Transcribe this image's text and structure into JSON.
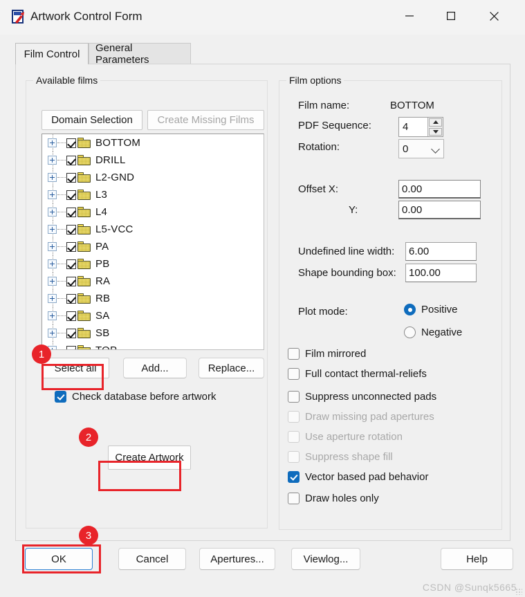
{
  "window": {
    "title": "Artwork Control Form",
    "icon": "artwork-app-icon",
    "minimize_label": "─",
    "maximize_label": "☐",
    "close_label": "✕"
  },
  "tabs": [
    {
      "label": "Film Control",
      "active": true
    },
    {
      "label": "General Parameters",
      "active": false
    }
  ],
  "available_films": {
    "group_label": "Available films",
    "buttons": {
      "domain_selection": "Domain Selection",
      "create_missing_films": "Create Missing Films",
      "select_all": "Select all",
      "add": "Add...",
      "replace": "Replace...",
      "create_artwork": "Create Artwork"
    },
    "tree_items": [
      {
        "label": "BOTTOM",
        "checked": true
      },
      {
        "label": "DRILL",
        "checked": true
      },
      {
        "label": "L2-GND",
        "checked": true
      },
      {
        "label": "L3",
        "checked": true
      },
      {
        "label": "L4",
        "checked": true
      },
      {
        "label": "L5-VCC",
        "checked": true
      },
      {
        "label": "PA",
        "checked": true
      },
      {
        "label": "PB",
        "checked": true
      },
      {
        "label": "RA",
        "checked": true
      },
      {
        "label": "RB",
        "checked": true
      },
      {
        "label": "SA",
        "checked": true
      },
      {
        "label": "SB",
        "checked": true
      },
      {
        "label": "TOP",
        "checked": true
      }
    ],
    "check_database": {
      "label": "Check database before artwork",
      "checked": true
    }
  },
  "film_options": {
    "group_label": "Film options",
    "film_name_label": "Film name:",
    "film_name_value": "BOTTOM",
    "pdf_sequence_label": "PDF Sequence:",
    "pdf_sequence_value": "4",
    "rotation_label": "Rotation:",
    "rotation_value": "0",
    "offset_x_label": "Offset  X:",
    "offset_x_value": "0.00",
    "offset_y_label": "Y:",
    "offset_y_value": "0.00",
    "undefined_line_width_label": "Undefined line width:",
    "undefined_line_width_value": "6.00",
    "shape_bounding_box_label": "Shape bounding box:",
    "shape_bounding_box_value": "100.00",
    "plot_mode_label": "Plot mode:",
    "plot_mode_options": [
      {
        "label": "Positive",
        "selected": true
      },
      {
        "label": "Negative",
        "selected": false
      }
    ],
    "checkboxes": [
      {
        "label": "Film mirrored",
        "checked": false,
        "disabled": false
      },
      {
        "label": "Full contact thermal-reliefs",
        "checked": false,
        "disabled": false
      },
      {
        "label": "Suppress unconnected pads",
        "checked": false,
        "disabled": false
      },
      {
        "label": "Draw missing pad apertures",
        "checked": false,
        "disabled": true
      },
      {
        "label": "Use aperture rotation",
        "checked": false,
        "disabled": true
      },
      {
        "label": "Suppress shape fill",
        "checked": false,
        "disabled": true
      },
      {
        "label": "Vector based pad behavior",
        "checked": true,
        "disabled": false
      },
      {
        "label": "Draw holes only",
        "checked": false,
        "disabled": false
      }
    ]
  },
  "bottom_buttons": [
    {
      "label": "OK",
      "focused": true
    },
    {
      "label": "Cancel",
      "focused": false
    },
    {
      "label": "Apertures...",
      "focused": false
    },
    {
      "label": "Viewlog...",
      "focused": false
    },
    {
      "label": "Help",
      "focused": false
    }
  ],
  "annotations": [
    {
      "number": "1",
      "target": "select-all-button"
    },
    {
      "number": "2",
      "target": "create-artwork-button"
    },
    {
      "number": "3",
      "target": "ok-button"
    }
  ],
  "watermark": "CSDN @Sunqk5665",
  "colors": {
    "accent": "#0f6cbd",
    "highlight": "#e8242a",
    "window_bg": "#f0f0f0",
    "folder": "#fbee8a"
  }
}
